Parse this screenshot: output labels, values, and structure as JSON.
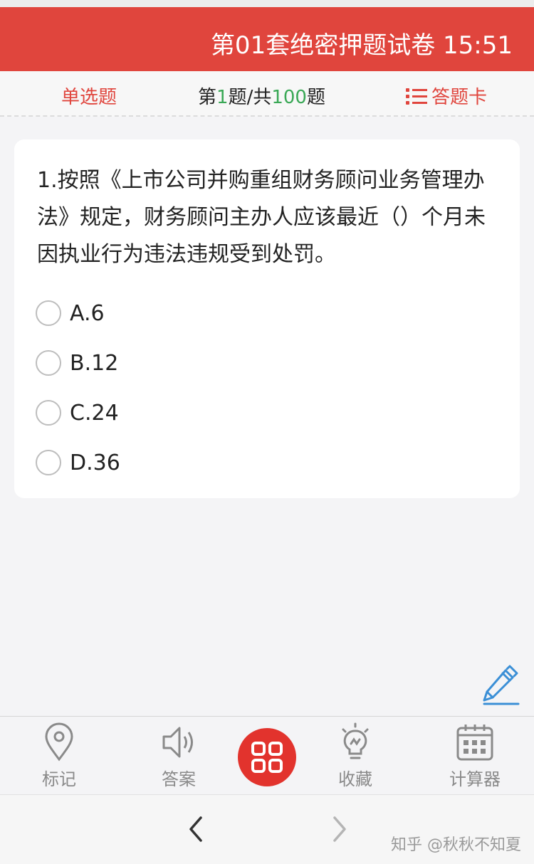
{
  "header": {
    "title": "第01套绝密押题试卷",
    "timer": "15:51"
  },
  "subbar": {
    "question_type": "单选题",
    "progress_prefix": "第",
    "current": "1",
    "progress_mid": "题/共",
    "total": "100",
    "progress_suffix": "题",
    "answer_card": "答题卡"
  },
  "question": {
    "text": "1.按照《上市公司并购重组财务顾问业务管理办法》规定，财务顾问主办人应该最近（）个月未因执业行为违法违规受到处罚。",
    "options": [
      "A.6",
      "B.12",
      "C.24",
      "D.36"
    ]
  },
  "bottom_tabs": {
    "mark": "标记",
    "answer": "答案",
    "favorite": "收藏",
    "calculator": "计算器"
  },
  "watermark": "知乎 @秋秋不知夏",
  "colors": {
    "accent": "#e0453d",
    "progress_number": "#3aa856",
    "pencil": "#3b8fd6"
  },
  "icons": [
    "map-pin-icon",
    "speaker-icon",
    "grid-icon",
    "lightbulb-icon",
    "calculator-icon",
    "pencil-icon",
    "chevron-left-icon",
    "chevron-right-icon",
    "list-icon"
  ]
}
